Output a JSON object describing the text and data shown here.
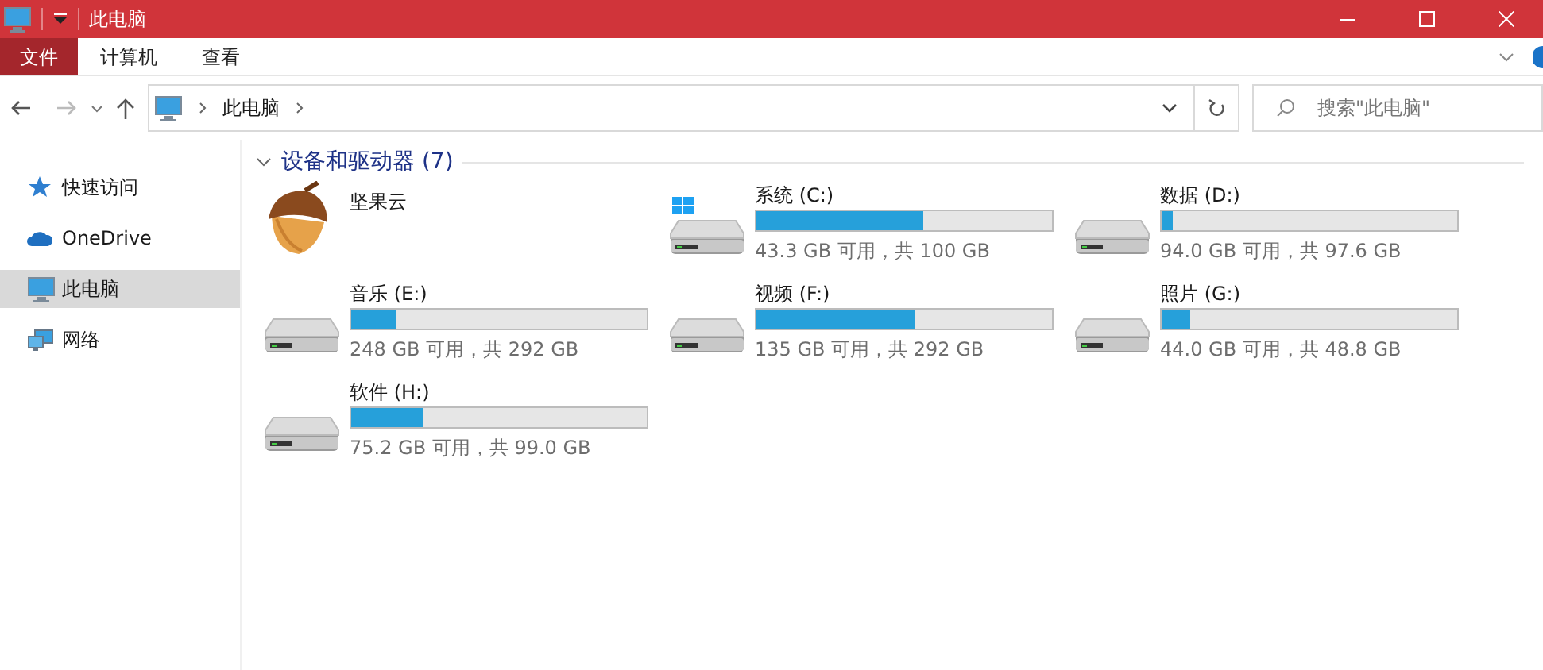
{
  "window": {
    "title": "此电脑"
  },
  "ribbon_tabs": [
    {
      "label": "文件",
      "selected": true
    },
    {
      "label": "计算机",
      "selected": false
    },
    {
      "label": "查看",
      "selected": false
    }
  ],
  "address_bar": {
    "path": [
      "此电脑"
    ]
  },
  "search": {
    "placeholder": "搜索\"此电脑\""
  },
  "sidebar": {
    "items": [
      {
        "label": "快速访问",
        "kind": "star",
        "selected": false
      },
      {
        "label": "OneDrive",
        "kind": "cloud",
        "selected": false
      },
      {
        "label": "此电脑",
        "kind": "computer",
        "selected": true
      },
      {
        "label": "网络",
        "kind": "network",
        "selected": false
      }
    ]
  },
  "section": {
    "title": "设备和驱动器 (7)",
    "expanded": true,
    "items": [
      {
        "kind": "app",
        "name": "坚果云"
      },
      {
        "kind": "system_drive",
        "name": "系统 (C:)",
        "level": 0.567,
        "space": "43.3 GB 可用，共 100 GB"
      },
      {
        "kind": "drive",
        "name": "数据 (D:)",
        "level": 0.037,
        "space": "94.0 GB 可用，共 97.6 GB"
      },
      {
        "kind": "drive",
        "name": "音乐 (E:)",
        "level": 0.151,
        "space": "248 GB 可用，共 292 GB"
      },
      {
        "kind": "drive",
        "name": "视频 (F:)",
        "level": 0.538,
        "space": "135 GB 可用，共 292 GB"
      },
      {
        "kind": "drive",
        "name": "照片 (G:)",
        "level": 0.098,
        "space": "44.0 GB 可用，共 48.8 GB"
      },
      {
        "kind": "drive",
        "name": "软件 (H:)",
        "level": 0.24,
        "space": "75.2 GB 可用，共 99.0 GB"
      }
    ]
  }
}
